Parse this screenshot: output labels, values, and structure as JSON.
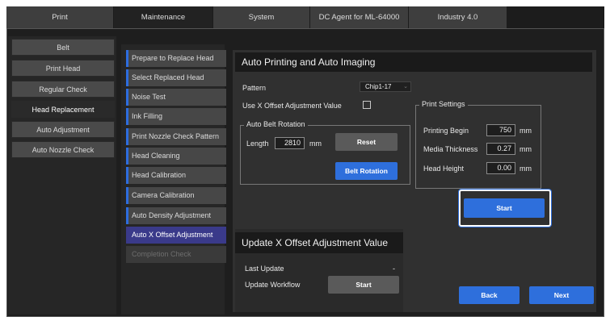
{
  "top_tabs": [
    "Print",
    "Maintenance",
    "System",
    "DC Agent for ML-64000",
    "Industry 4.0"
  ],
  "left_nav": {
    "items": [
      "Belt",
      "Print Head",
      "Regular Check",
      "Head Replacement",
      "Auto Adjustment",
      "Auto Nozzle Check"
    ],
    "active": "Head Replacement"
  },
  "steps": {
    "items": [
      "Prepare to Replace Head",
      "Select Replaced Head",
      "Noise Test",
      "Ink Filling",
      "Print Nozzle Check Pattern",
      "Head Cleaning",
      "Head Calibration",
      "Camera Calibration",
      "Auto Density Adjustment",
      "Auto X Offset Adjustment",
      "Completion Check"
    ],
    "active": "Auto X Offset Adjustment",
    "disabled": "Completion Check"
  },
  "auto_panel": {
    "title": "Auto Printing and Auto Imaging",
    "pattern_label": "Pattern",
    "pattern_value": "Chip1-17",
    "use_x_offset_label": "Use X Offset Adjustment Value",
    "use_x_offset_checked": false,
    "belt_group": {
      "title": "Auto Belt Rotation",
      "length_label": "Length",
      "length_value": "2810",
      "length_unit": "mm",
      "reset_label": "Reset",
      "rotation_label": "Belt Rotation"
    },
    "print_settings": {
      "title": "Print Settings",
      "printing_begin_label": "Printing Begin",
      "printing_begin_value": "750",
      "media_thickness_label": "Media Thickness",
      "media_thickness_value": "0.27",
      "head_height_label": "Head Height",
      "head_height_value": "0.00",
      "unit": "mm"
    },
    "start_label": "Start"
  },
  "update_panel": {
    "title": "Update X Offset Adjustment Value",
    "last_update_label": "Last Update",
    "last_update_value": "-",
    "workflow_label": "Update Workflow",
    "start_label": "Start"
  },
  "nav_buttons": {
    "back": "Back",
    "next": "Next"
  },
  "colors": {
    "accent": "#2e6fdc",
    "active_step": "#3a3a8a",
    "background": "#1e1e1e"
  }
}
